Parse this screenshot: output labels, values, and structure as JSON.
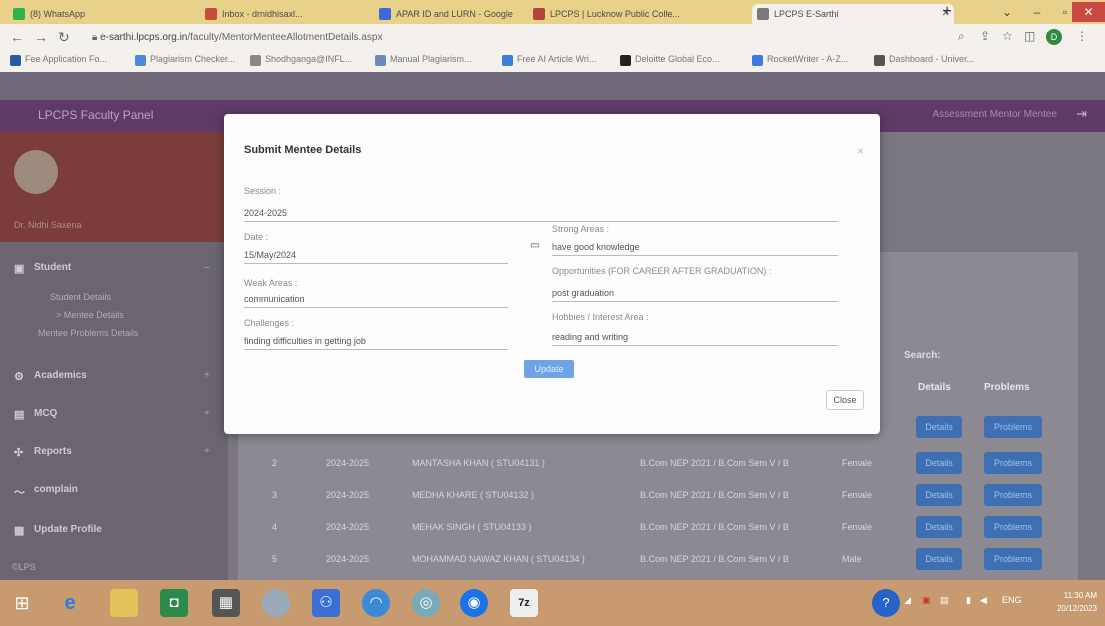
{
  "browser": {
    "tabs": [
      {
        "label": "(8) WhatsApp",
        "color": "#2fb24b"
      },
      {
        "label": "Inbox - drnidhisaxl...",
        "color": "#c94b3b"
      },
      {
        "label": "APAR ID and LURN - Google",
        "color": "#3d6bd8"
      },
      {
        "label": "LPCPS | Lucknow Public Colle...",
        "color": "#b5433b"
      },
      {
        "label": "LPCPS E-Sarthi",
        "color": "#7a7a7a"
      }
    ],
    "url_domain": "e-sarthi.lpcps.org.in",
    "url_path": "/faculty/MentorMenteeAllotmentDetails.aspx",
    "bookmarks": [
      {
        "label": "Fee Application Fo...",
        "color": "#2c5aa0"
      },
      {
        "label": "Plagiarism Checker...",
        "color": "#4b89d9"
      },
      {
        "label": "Shodhganga@INFL...",
        "color": "#888"
      },
      {
        "label": "Manual Plagiarism...",
        "color": "#6b8cb8"
      },
      {
        "label": "Free AI Article Wri...",
        "color": "#3e7fd6"
      },
      {
        "label": "Deloitte Global Eco...",
        "color": "#222"
      },
      {
        "label": "RocketWriter - A-Z...",
        "color": "#3a7be0"
      },
      {
        "label": "Dashboard - Univer...",
        "color": "#555"
      }
    ]
  },
  "app": {
    "brand": "LPCPS Faculty Panel",
    "profile_name": "Dr. Nidhi Saxena",
    "top_link": "Assessment Mentor Mentee"
  },
  "sidebar": {
    "student": "Student",
    "student_details": "Student Details",
    "mentee_details": "> Mentee Details",
    "mentee_problems": "Mentee Problems Details",
    "academics": "Academics",
    "mcq": "MCQ",
    "reports": "Reports",
    "complain": "complain",
    "update_profile": "Update Profile",
    "footer": "©LPS"
  },
  "table": {
    "search_label": "Search:",
    "col_details": "Details",
    "col_problems": "Problems",
    "details_btn": "Details",
    "problems_btn": "Problems",
    "rows": [
      {
        "sno": "2",
        "session": "2024-2025",
        "name": "MANTASHA KHAN ( STU04131 )",
        "course": "B.Com NEP 2021 / B.Com Sem V / B",
        "gender": "Female"
      },
      {
        "sno": "3",
        "session": "2024-2025",
        "name": "MEDHA KHARE ( STU04132 )",
        "course": "B.Com NEP 2021 / B.Com Sem V / B",
        "gender": "Female"
      },
      {
        "sno": "4",
        "session": "2024-2025",
        "name": "MEHAK SINGH ( STU04133 )",
        "course": "B.Com NEP 2021 / B.Com Sem V / B",
        "gender": "Female"
      },
      {
        "sno": "5",
        "session": "2024-2025",
        "name": "MOHAMMAD NAWAZ KHAN ( STU04134 )",
        "course": "B.Com NEP 2021 / B.Com Sem V / B",
        "gender": "Male"
      }
    ]
  },
  "modal": {
    "title": "Submit Mentee Details",
    "session_label": "Session :",
    "session_value": "2024-2025",
    "date_label": "Date :",
    "date_value": "15/May/2024",
    "strong_label": "Strong Areas :",
    "strong_value": "have good knowledge",
    "weak_label": "Weak Areas :",
    "weak_value": "communication",
    "opp_label": "Opportunities (FOR CAREER AFTER GRADUATION) :",
    "opp_value": "post graduation",
    "challenges_label": "Challenges :",
    "challenges_value": "finding difficulties in getting job",
    "hobbies_label": "Hobbies / Interest Area :",
    "hobbies_value": "reading and writing",
    "update_btn": "Update",
    "close_btn": "Close"
  },
  "taskbar": {
    "lang": "ENG",
    "time": "11:30 AM",
    "date": "20/12/2023"
  }
}
